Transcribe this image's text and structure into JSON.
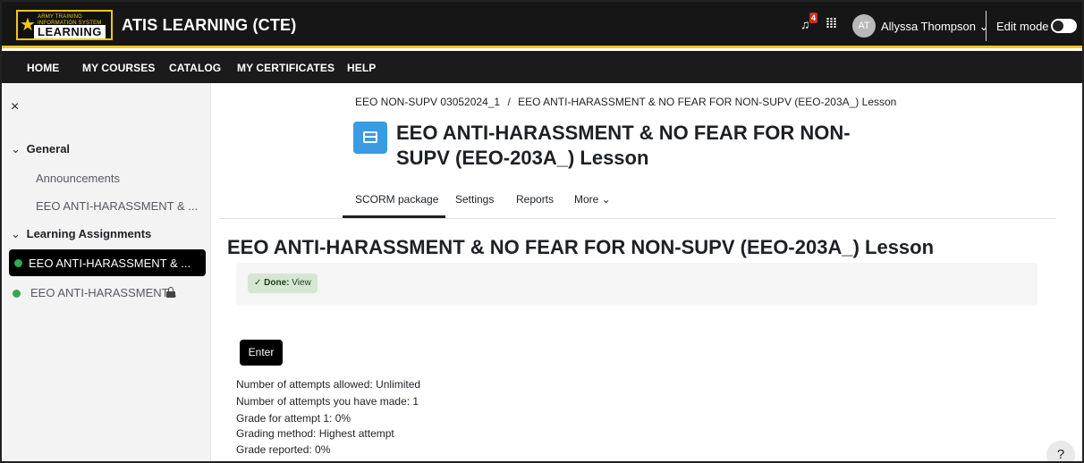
{
  "header": {
    "logo": {
      "top": "ARMY TRAINING INFORMATION SYSTEM",
      "main": "LEARNING"
    },
    "site_title": "ATIS LEARNING (CTE)",
    "notifications_count": "4",
    "user": {
      "initials": "AT",
      "name": "Allyssa Thompson",
      "chevron": "⌄"
    },
    "edit_mode_label": "Edit mode",
    "edit_mode_on": false
  },
  "nav": [
    "HOME",
    "MY COURSES",
    "CATALOG",
    "MY CERTIFICATES",
    "HELP"
  ],
  "drawer": {
    "close_glyph": "×",
    "sections": [
      {
        "label": "General",
        "items": [
          "Announcements",
          "EEO ANTI-HARASSMENT & ..."
        ]
      },
      {
        "label": "Learning Assignments",
        "items": [
          "EEO ANTI-HARASSMENT & ...",
          "EEO ANTI-HARASSMENT..."
        ]
      }
    ]
  },
  "breadcrumb": {
    "course": "EEO NON-SUPV 03052024_1",
    "separator": "/",
    "current": "EEO ANTI-HARASSMENT & NO FEAR FOR NON-SUPV (EEO-203A_) Lesson"
  },
  "page_title": "EEO ANTI-HARASSMENT & NO FEAR FOR NON-SUPV (EEO-203A_) Lesson",
  "tabs": [
    "SCORM package",
    "Settings",
    "Reports",
    "More ⌄"
  ],
  "content_title": "EEO ANTI-HARASSMENT & NO FEAR FOR NON-SUPV (EEO-203A_) Lesson",
  "completion": {
    "check": "✓",
    "label": "Done:",
    "value": "View"
  },
  "enter_button": "Enter",
  "attempt_info": [
    "Number of attempts allowed: Unlimited",
    "Number of attempts you have made: 1",
    "Grade for attempt 1: 0%",
    "Grading method: Highest attempt",
    "Grade reported: 0%"
  ],
  "help_glyph": "?",
  "icons": [
    "bell-icon",
    "apps-grid-icon",
    "close-icon",
    "chevron-down-icon",
    "scorm-package-icon",
    "lock-icon",
    "check-icon",
    "help-icon"
  ],
  "colors": {
    "accent_yellow": "#f5c518",
    "topbar": "#161616",
    "scorm_icon": "#399be2",
    "complete_dot": "#35a853",
    "notification_badge": "#ca3120"
  }
}
